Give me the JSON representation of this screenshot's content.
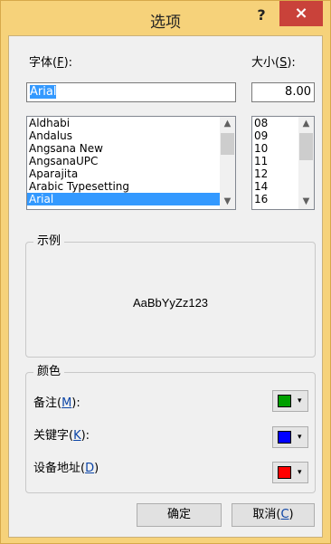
{
  "window": {
    "title": "选项",
    "help_label": "?",
    "close_label": "×"
  },
  "font": {
    "label_prefix": "字体(",
    "label_key": "F",
    "label_suffix": "):",
    "value": "Arial",
    "items": [
      "Aldhabi",
      "Andalus",
      "Angsana New",
      "AngsanaUPC",
      "Aparajita",
      "Arabic Typesetting",
      "Arial"
    ],
    "selected_index": 6
  },
  "size": {
    "label_prefix": "大小(",
    "label_key": "S",
    "label_suffix": "):",
    "value": "8.00",
    "items": [
      "08",
      "09",
      "10",
      "11",
      "12",
      "14",
      "16"
    ]
  },
  "sample": {
    "title": "示例",
    "text": "AaBbYyZz123"
  },
  "colors": {
    "title": "颜色",
    "rows": [
      {
        "prefix": "备注(",
        "key": "M",
        "suffix": "):",
        "color": "#00a000"
      },
      {
        "prefix": "关键字(",
        "key": "K",
        "suffix": "):",
        "color": "#0000ff"
      },
      {
        "prefix": "设备地址(",
        "key": "D",
        "suffix": ")",
        "color": "#ff0000"
      }
    ],
    "dropdown_caret": "▾"
  },
  "buttons": {
    "ok": "确定",
    "cancel_prefix": "取消(",
    "cancel_key": "C",
    "cancel_suffix": ")"
  },
  "scroll": {
    "up": "▲",
    "down": "▼"
  }
}
